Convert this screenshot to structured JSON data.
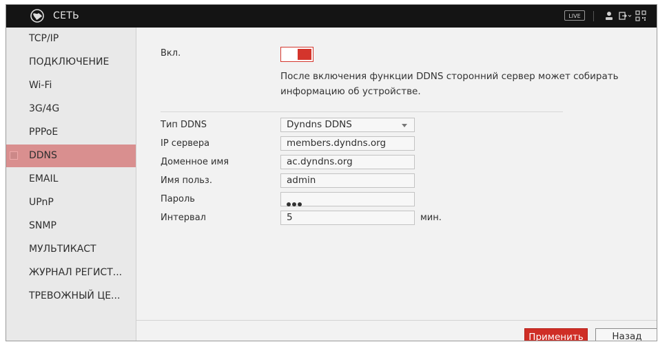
{
  "window": {
    "title": "СЕТЬ",
    "live_label": "LIVE"
  },
  "titlebar_icons": [
    "globe-icon",
    "user-icon",
    "logout-icon",
    "qr-code-icon"
  ],
  "sidebar": {
    "items": [
      {
        "label": "TCP/IP"
      },
      {
        "label": "ПОДКЛЮЧЕНИЕ"
      },
      {
        "label": "Wi-Fi"
      },
      {
        "label": "3G/4G"
      },
      {
        "label": "PPPoE"
      },
      {
        "label": "DDNS",
        "active": true
      },
      {
        "label": "EMAIL"
      },
      {
        "label": "UPnP"
      },
      {
        "label": "SNMP"
      },
      {
        "label": "МУЛЬТИКАСТ"
      },
      {
        "label": "ЖУРНАЛ РЕГИСТ..."
      },
      {
        "label": "ТРЕВОЖНЫЙ ЦЕ..."
      }
    ]
  },
  "ddns": {
    "enable_label": "Вкл.",
    "enabled": true,
    "notice": "После включения функции DDNS сторонний сервер может собирать информацию об устройстве.",
    "type_label": "Тип DDNS",
    "type_value": "Dyndns DDNS",
    "server_label": "IP сервера",
    "server_value": "members.dyndns.org",
    "domain_label": "Доменное имя",
    "domain_value": "ac.dyndns.org",
    "user_label": "Имя польз.",
    "user_value": "admin",
    "password_label": "Пароль",
    "password_masked": "●●●",
    "interval_label": "Интервал",
    "interval_value": "5",
    "interval_unit": "мин."
  },
  "buttons": {
    "apply": "Применить",
    "back": "Назад"
  },
  "colors": {
    "accent": "#cf2e26",
    "active_item": "#d98f8f",
    "titlebar": "#141414"
  }
}
